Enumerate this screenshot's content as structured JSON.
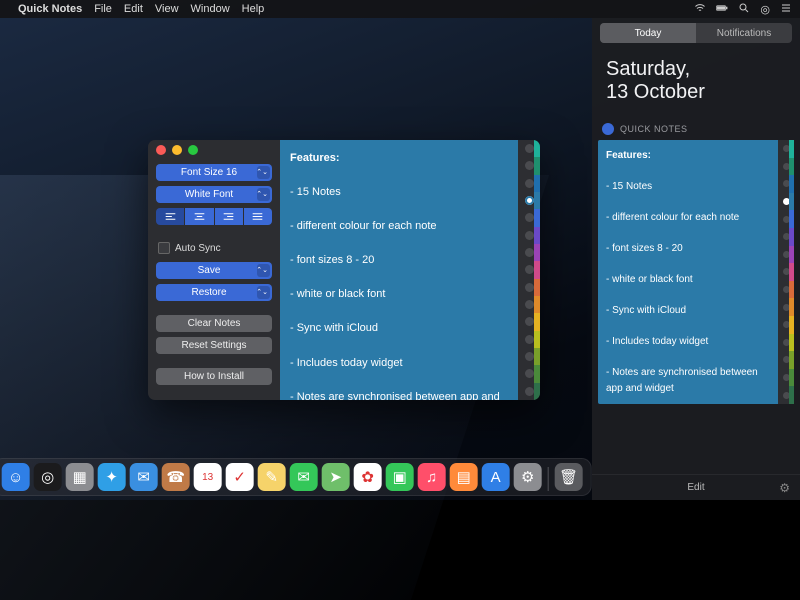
{
  "menubar": {
    "app_name": "Quick Notes",
    "items": [
      "File",
      "Edit",
      "View",
      "Window",
      "Help"
    ]
  },
  "window": {
    "settings": {
      "font_size_label": "Font Size 16",
      "font_color_label": "White Font",
      "auto_sync_label": "Auto Sync",
      "auto_sync_checked": false,
      "save_label": "Save",
      "restore_label": "Restore",
      "clear_notes_label": "Clear Notes",
      "reset_settings_label": "Reset Settings",
      "how_to_install_label": "How to Install"
    },
    "note": {
      "title": "Features:",
      "lines": [
        "- 15 Notes",
        "- different colour for each note",
        "- font sizes 8 - 20",
        "- white or black font",
        "- Sync with iCloud",
        "- Includes today widget",
        "- Notes are synchronised between app and widget"
      ]
    },
    "colors": [
      "#1fb29a",
      "#1f8f6e",
      "#1f6fae",
      "#2b7aa8",
      "#3a69d6",
      "#6a49c8",
      "#9a43b6",
      "#d04a8a",
      "#d86a3a",
      "#df8a2a",
      "#e6b222",
      "#b8bf1f",
      "#79a02a",
      "#4a8a3a",
      "#2e6f4a"
    ],
    "selected_color_index": 3
  },
  "nc": {
    "tabs": {
      "today": "Today",
      "notifications": "Notifications"
    },
    "date_line1": "Saturday,",
    "date_line2": "13 October",
    "widget_title": "QUICK NOTES",
    "edit_label": "Edit"
  },
  "dock": {
    "apps": [
      {
        "name": "finder",
        "bg": "#2f7fe6",
        "glyph": "☺"
      },
      {
        "name": "siri",
        "bg": "#1b1b1d",
        "glyph": "◎"
      },
      {
        "name": "launchpad",
        "bg": "#8c8d91",
        "glyph": "▦"
      },
      {
        "name": "safari",
        "bg": "#2f9fe6",
        "glyph": "✦"
      },
      {
        "name": "mail",
        "bg": "#3a8fe0",
        "glyph": "✉"
      },
      {
        "name": "contacts",
        "bg": "#c07a47",
        "glyph": "☎"
      },
      {
        "name": "calendar",
        "bg": "#ffffff",
        "glyph": "13"
      },
      {
        "name": "reminders",
        "bg": "#ffffff",
        "glyph": "✓"
      },
      {
        "name": "notes",
        "bg": "#f6d36a",
        "glyph": "✎"
      },
      {
        "name": "messages",
        "bg": "#34c759",
        "glyph": "✉"
      },
      {
        "name": "maps",
        "bg": "#6fbf6a",
        "glyph": "➤"
      },
      {
        "name": "photos",
        "bg": "#ffffff",
        "glyph": "✿"
      },
      {
        "name": "facetime",
        "bg": "#34c759",
        "glyph": "▣"
      },
      {
        "name": "itunes",
        "bg": "#ff4f6a",
        "glyph": "♫"
      },
      {
        "name": "ibooks",
        "bg": "#ff8a3a",
        "glyph": "▤"
      },
      {
        "name": "appstore",
        "bg": "#2f7fe6",
        "glyph": "A"
      },
      {
        "name": "preferences",
        "bg": "#8c8d91",
        "glyph": "⚙"
      }
    ]
  }
}
